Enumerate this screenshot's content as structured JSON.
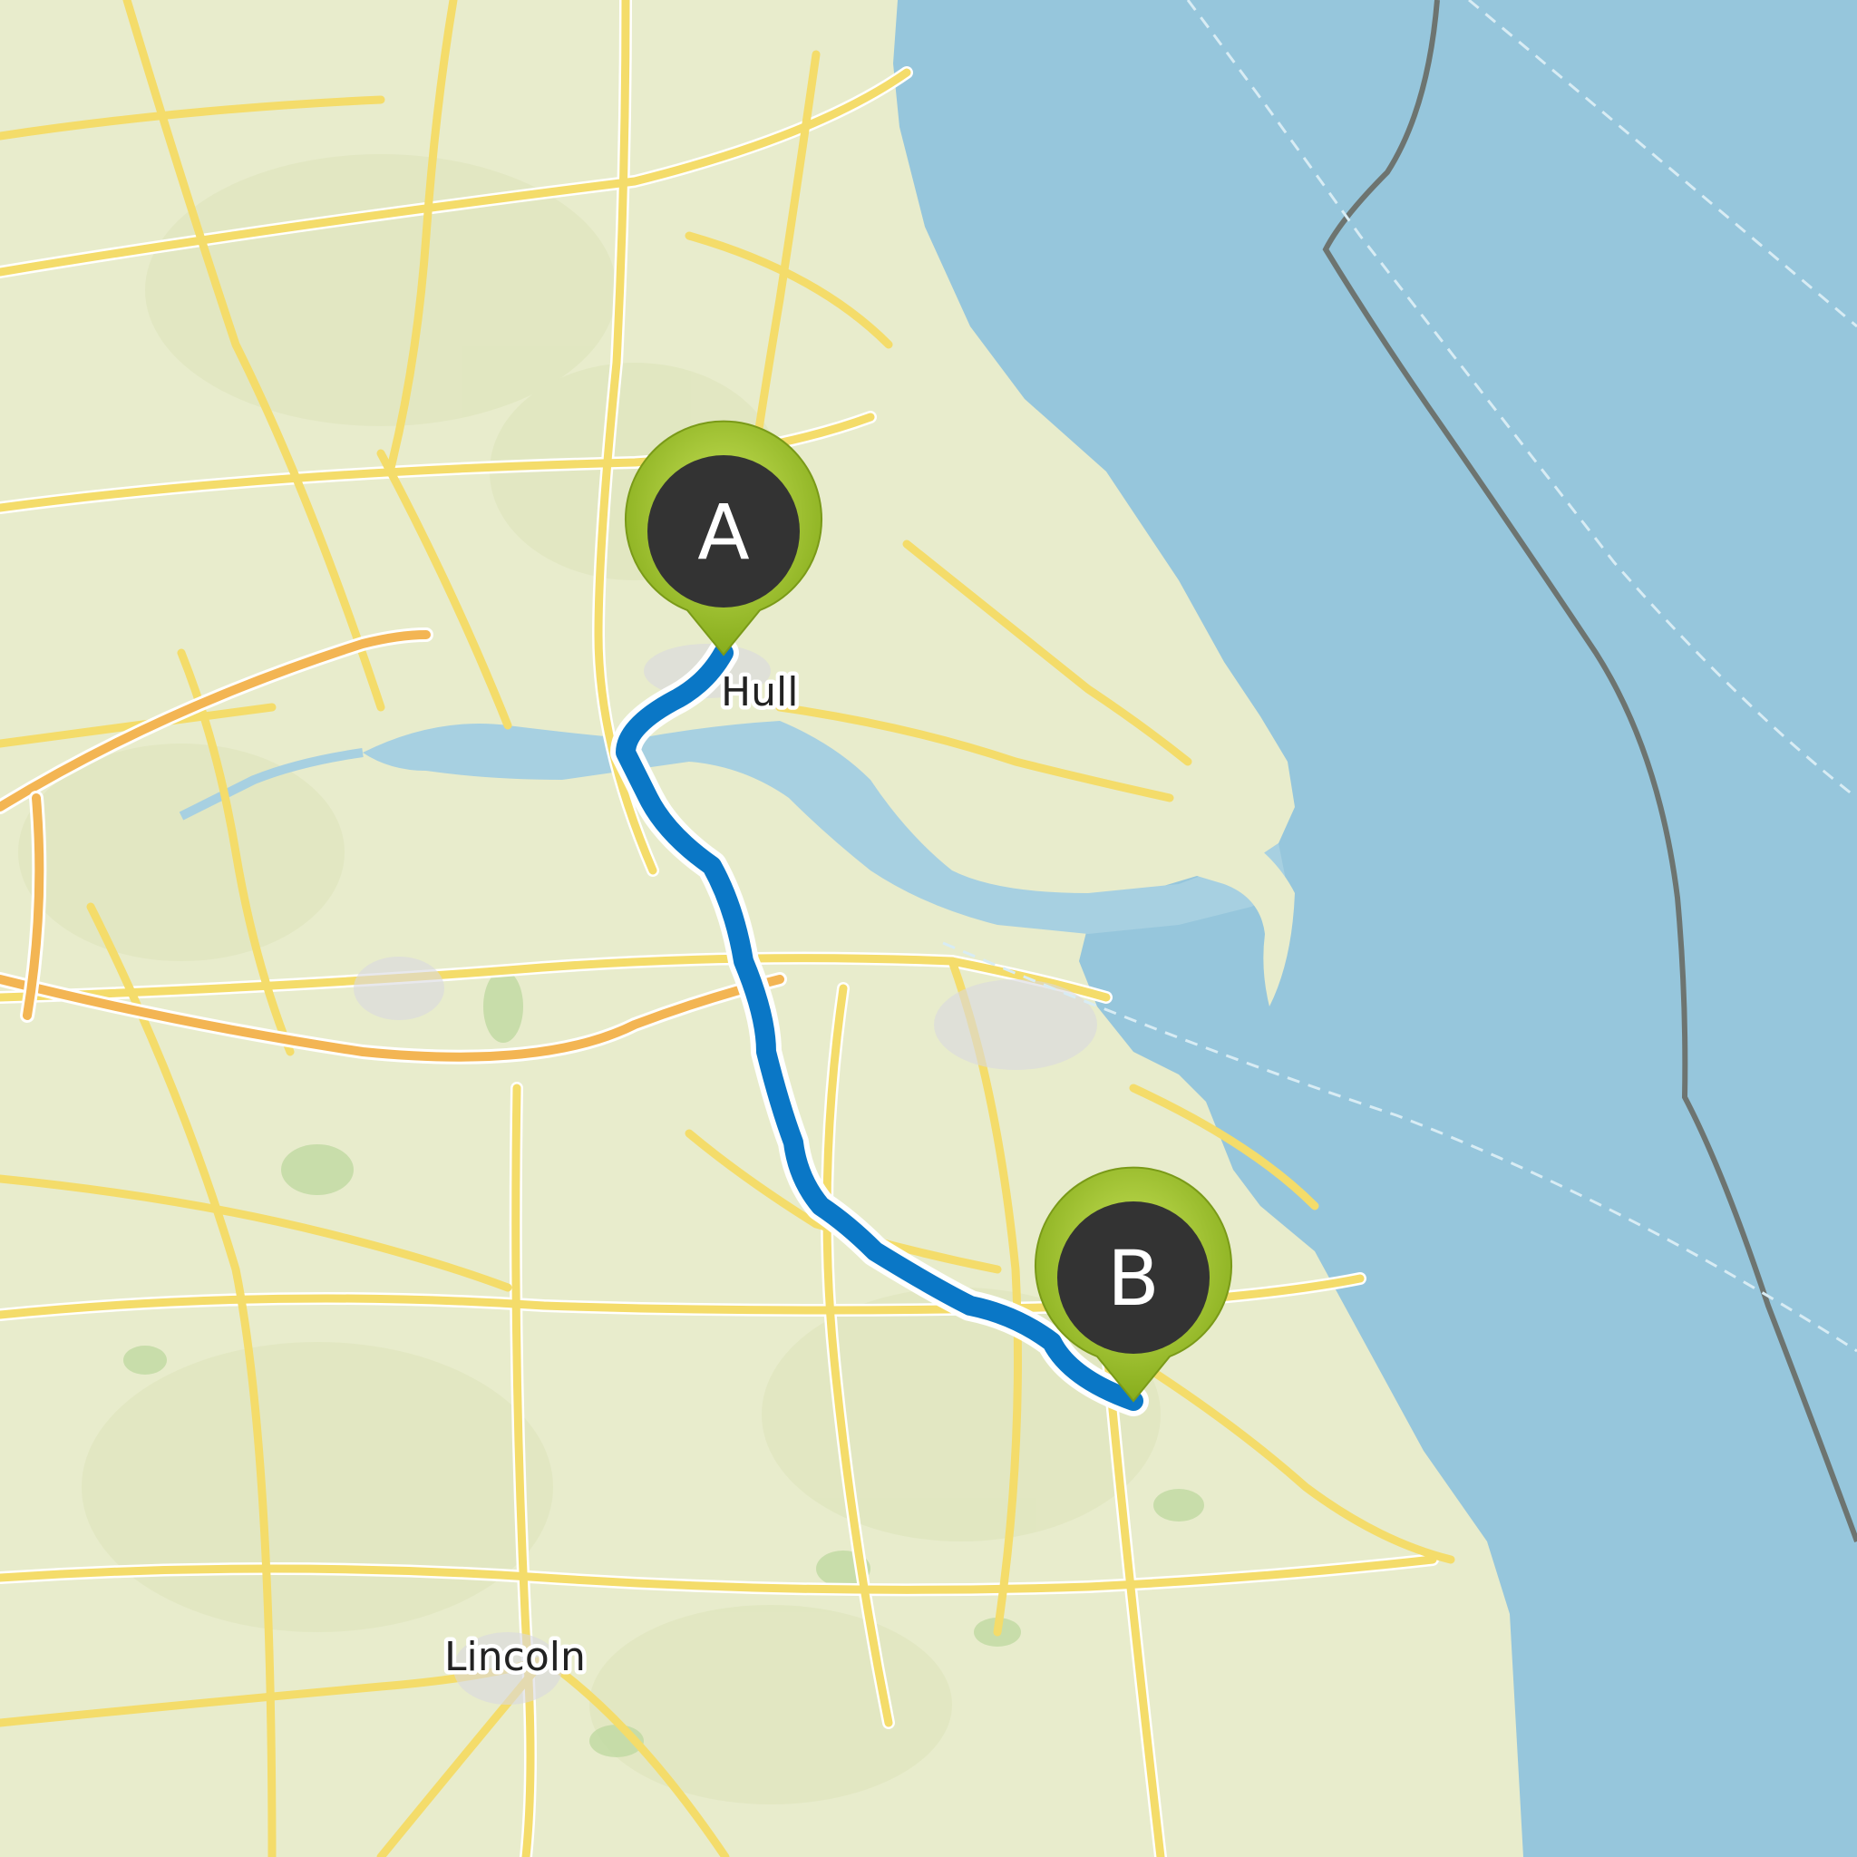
{
  "map": {
    "labels": {
      "hull": "Hull",
      "lincoln": "Lincoln"
    },
    "markers": {
      "start": {
        "letter": "A"
      },
      "end": {
        "letter": "B"
      }
    },
    "colors": {
      "land": "#e8eccc",
      "sea": "#96c6dc",
      "estuary": "#a7d0e1",
      "road": "#f4dc6a",
      "road_casing": "#ffffff",
      "motorway": "#f3b553",
      "route": "#0a77c6",
      "route_outline": "#ffffff",
      "marker_fill": "#333333",
      "marker_ring": "#9ec42a",
      "boundary": "#6d7470"
    }
  }
}
